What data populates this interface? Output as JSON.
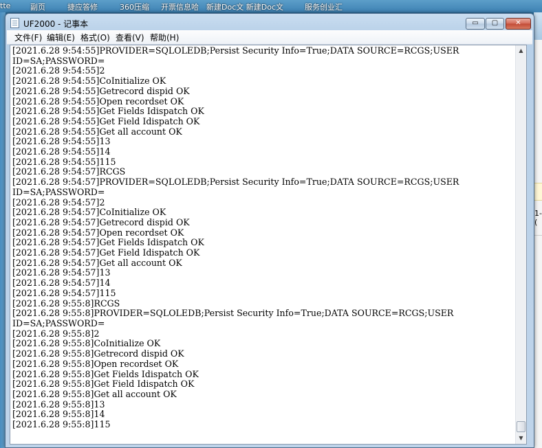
{
  "desktop": {
    "top_labels": [
      "tte",
      "副页",
      "捷应答修",
      "360压缩",
      "开票信息哈",
      "新建Doc文 新建Doc文",
      "服务创业汇"
    ],
    "behind_window_text": "1-("
  },
  "window": {
    "title": "UF2000 - 记事本",
    "controls": {
      "minimize": "▭",
      "maximize": "▢",
      "close": "✕"
    }
  },
  "menu": [
    {
      "label": "文件(F)"
    },
    {
      "label": "编辑(E)"
    },
    {
      "label": "格式(O)"
    },
    {
      "label": "查看(V)"
    },
    {
      "label": "帮助(H)"
    }
  ],
  "content": {
    "lines": [
      "[2021.6.28 9:54:55]PROVIDER=SQLOLEDB;Persist Security Info=True;DATA SOURCE=RCGS;USER",
      "ID=SA;PASSWORD=",
      "[2021.6.28 9:54:55]2",
      "[2021.6.28 9:54:55]CoInitialize OK",
      "[2021.6.28 9:54:55]Getrecord dispid OK",
      "[2021.6.28 9:54:55]Open recordset OK",
      "[2021.6.28 9:54:55]Get Fields Idispatch OK",
      "[2021.6.28 9:54:55]Get Field Idispatch OK",
      "[2021.6.28 9:54:55]Get all account OK",
      "[2021.6.28 9:54:55]13",
      "[2021.6.28 9:54:55]14",
      "[2021.6.28 9:54:55]115",
      "[2021.6.28 9:54:57]RCGS",
      "[2021.6.28 9:54:57]PROVIDER=SQLOLEDB;Persist Security Info=True;DATA SOURCE=RCGS;USER",
      "ID=SA;PASSWORD=",
      "[2021.6.28 9:54:57]2",
      "[2021.6.28 9:54:57]CoInitialize OK",
      "[2021.6.28 9:54:57]Getrecord dispid OK",
      "[2021.6.28 9:54:57]Open recordset OK",
      "[2021.6.28 9:54:57]Get Fields Idispatch OK",
      "[2021.6.28 9:54:57]Get Field Idispatch OK",
      "[2021.6.28 9:54:57]Get all account OK",
      "[2021.6.28 9:54:57]13",
      "[2021.6.28 9:54:57]14",
      "[2021.6.28 9:54:57]115",
      "[2021.6.28 9:55:8]RCGS",
      "[2021.6.28 9:55:8]PROVIDER=SQLOLEDB;Persist Security Info=True;DATA SOURCE=RCGS;USER",
      "ID=SA;PASSWORD=",
      "[2021.6.28 9:55:8]2",
      "[2021.6.28 9:55:8]CoInitialize OK",
      "[2021.6.28 9:55:8]Getrecord dispid OK",
      "[2021.6.28 9:55:8]Open recordset OK",
      "[2021.6.28 9:55:8]Get Fields Idispatch OK",
      "[2021.6.28 9:55:8]Get Field Idispatch OK",
      "[2021.6.28 9:55:8]Get all account OK",
      "[2021.6.28 9:55:8]13",
      "[2021.6.28 9:55:8]14",
      "[2021.6.28 9:55:8]115"
    ]
  },
  "scrollbar": {
    "up_arrow": "▲",
    "down_arrow": "▼",
    "position": 1.0
  }
}
